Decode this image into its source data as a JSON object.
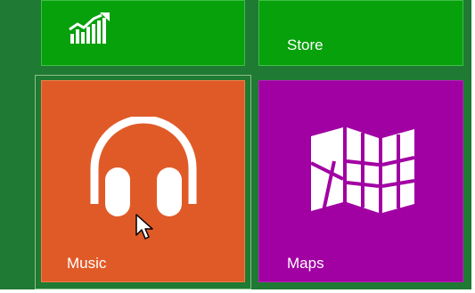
{
  "start_screen": {
    "background_color": "#1f7a33",
    "tiles": {
      "finance": {
        "label": "",
        "color": "#06a10b",
        "icon": "finance-chart-icon"
      },
      "store": {
        "label": "Store",
        "color": "#06a10b",
        "icon": ""
      },
      "music": {
        "label": "Music",
        "color": "#e05a28",
        "icon": "headphones-icon",
        "selected": true
      },
      "maps": {
        "label": "Maps",
        "color": "#a100a3",
        "icon": "folded-map-icon"
      }
    }
  },
  "cursor": {
    "icon": "mouse-pointer-icon"
  }
}
